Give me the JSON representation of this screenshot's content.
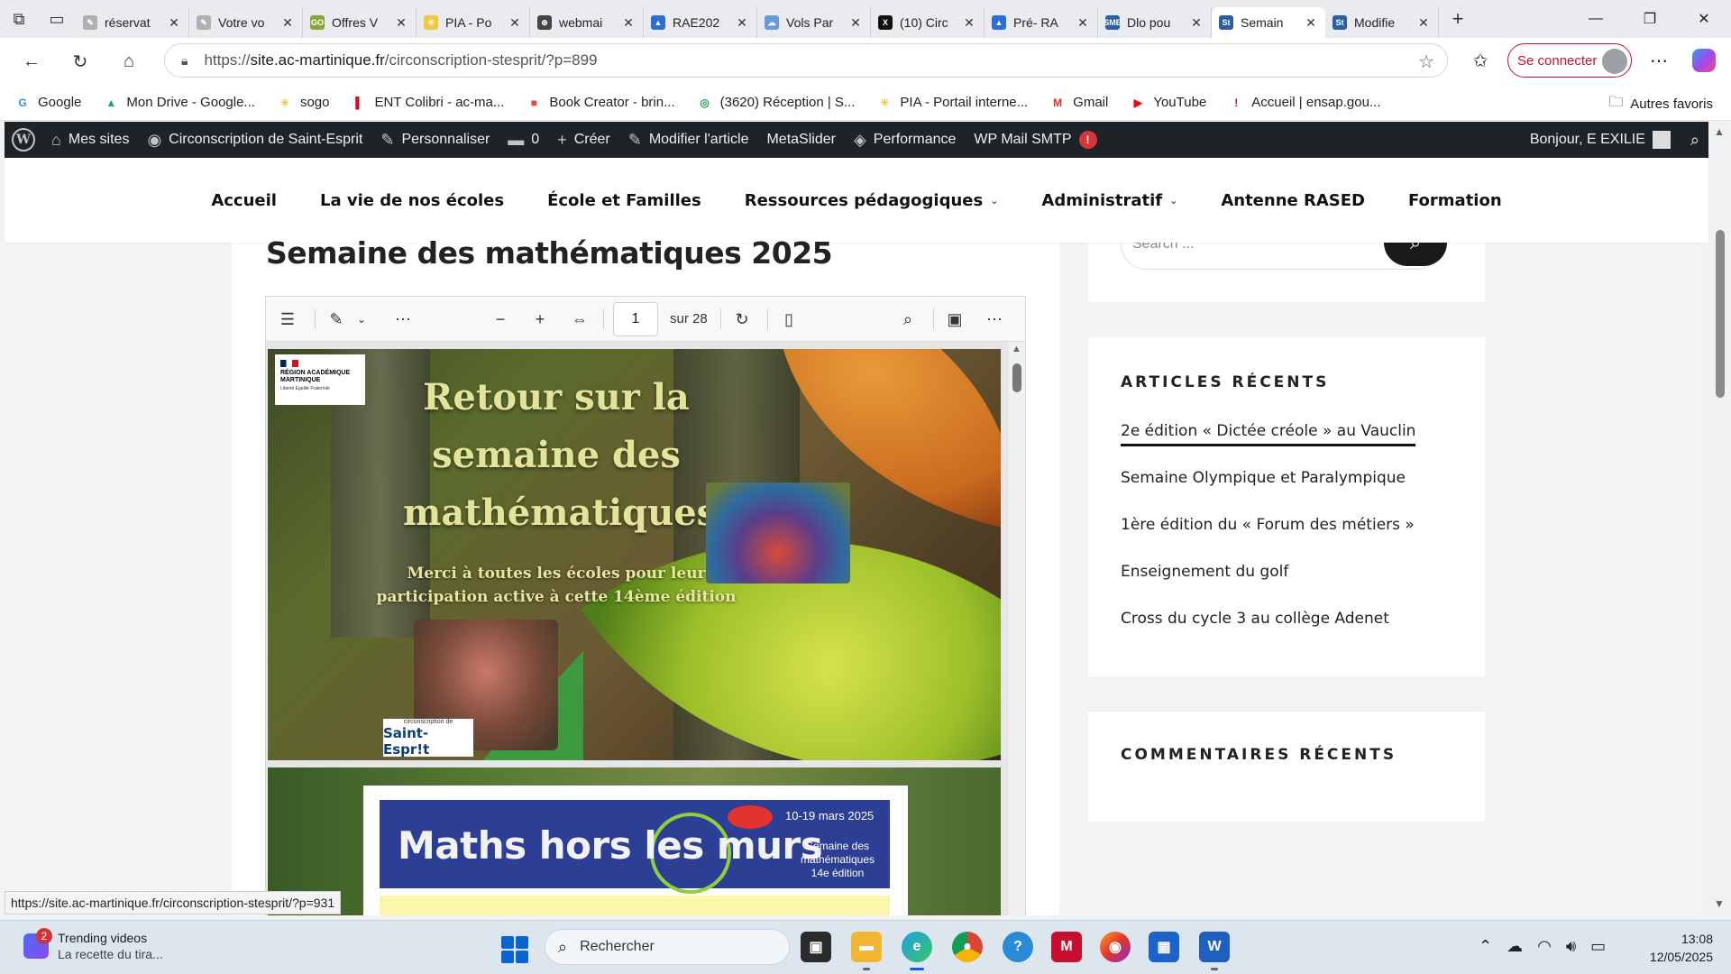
{
  "browser": {
    "tabs": [
      {
        "title": "réservat",
        "color": "#b0b0b0",
        "glyph": "✎"
      },
      {
        "title": "Votre vo",
        "color": "#b0b0b0",
        "glyph": "✎"
      },
      {
        "title": "Offres V",
        "color": "#8aa63a",
        "glyph": "GO"
      },
      {
        "title": "PIA - Po",
        "color": "#f2c744",
        "glyph": "☀"
      },
      {
        "title": "webmai",
        "color": "#444444",
        "glyph": "⊕"
      },
      {
        "title": "RAE202",
        "color": "#2a6fd6",
        "glyph": "▲"
      },
      {
        "title": "Vols Par",
        "color": "#6a9ad6",
        "glyph": "☁"
      },
      {
        "title": "(10) Circ",
        "color": "#111111",
        "glyph": "X"
      },
      {
        "title": "Pré- RA",
        "color": "#2a6fd6",
        "glyph": "▲"
      },
      {
        "title": "Dlo pou",
        "color": "#2a5fa8",
        "glyph": "SME"
      },
      {
        "title": "Semain",
        "color": "#2a5fa8",
        "glyph": "St"
      },
      {
        "title": "Modifie",
        "color": "#2a5fa8",
        "glyph": "St"
      }
    ],
    "active_tab_index": 10,
    "url_prefix": "https://",
    "url_domain": "site.ac-martinique.fr",
    "url_path": "/circonscription-stesprit/?p=899",
    "signin_label": "Se connecter",
    "favorites": [
      {
        "label": "Google",
        "glyph": "G",
        "color": "#4285f4"
      },
      {
        "label": "Mon Drive - Google...",
        "glyph": "▲",
        "color": "#1fa463"
      },
      {
        "label": "sogo",
        "glyph": "☀",
        "color": "#f2c744"
      },
      {
        "label": "ENT Colibri - ac-ma...",
        "glyph": "▌",
        "color": "#c8102e"
      },
      {
        "label": "Book Creator - brin...",
        "glyph": "■",
        "color": "#e8453c"
      },
      {
        "label": "(3620) Réception | S...",
        "glyph": "◎",
        "color": "#1f9e4a"
      },
      {
        "label": "PIA - Portail interne...",
        "glyph": "☀",
        "color": "#f2c744"
      },
      {
        "label": "Gmail",
        "glyph": "M",
        "color": "#d93025"
      },
      {
        "label": "YouTube",
        "glyph": "▶",
        "color": "#ff0000"
      },
      {
        "label": "Accueil | ensap.gou...",
        "glyph": "!",
        "color": "#c8102e"
      }
    ],
    "other_favorites": "Autres favoris",
    "status_url": "https://site.ac-martinique.fr/circonscription-stesprit/?p=931"
  },
  "wp_admin_bar": {
    "items": [
      {
        "label": "Mes sites",
        "icon": "⌂"
      },
      {
        "label": "Circonscription de Saint-Esprit",
        "icon": "◉"
      },
      {
        "label": "Personnaliser",
        "icon": "✎"
      },
      {
        "label": "0",
        "icon": "▬"
      },
      {
        "label": "Créer",
        "icon": "+"
      },
      {
        "label": "Modifier l'article",
        "icon": "✎"
      },
      {
        "label": "MetaSlider",
        "icon": ""
      },
      {
        "label": "Performance",
        "icon": "◈"
      },
      {
        "label": "WP Mail SMTP",
        "icon": ""
      }
    ],
    "smtp_badge": "!",
    "greeting": "Bonjour, E EXILIE"
  },
  "site": {
    "menu": [
      {
        "label": "Accueil",
        "dropdown": false
      },
      {
        "label": "La vie de nos écoles",
        "dropdown": false
      },
      {
        "label": "École et Familles",
        "dropdown": false
      },
      {
        "label": "Ressources pédagogiques",
        "dropdown": true
      },
      {
        "label": "Administratif",
        "dropdown": true
      },
      {
        "label": "Antenne RASED",
        "dropdown": false
      },
      {
        "label": "Formation",
        "dropdown": false
      }
    ],
    "page_title": "Semaine des mathématiques 2025",
    "pdf": {
      "current_page": "1",
      "total_label": "sur 28",
      "page1": {
        "logo_line1": "RÉGION ACADÉMIQUE",
        "logo_line2": "MARTINIQUE",
        "logo_motto": "Liberté Égalité Fraternité",
        "title": "Retour sur la semaine des mathématiques",
        "subtitle": "Merci à toutes les écoles pour leur participation active à cette 14ème édition",
        "circ_small": "circonscription de",
        "circ_name": "Saint-Espr!t"
      },
      "page2": {
        "banner_title": "Maths hors les murs",
        "dates": "10-19 mars 2025",
        "edition": "Semaine des mathématiques 14e édition"
      }
    },
    "sidebar": {
      "search_placeholder": "Search ...",
      "recent_title": "ARTICLES RÉCENTS",
      "recent_articles": [
        "2e édition « Dictée créole » au Vauclin",
        "Semaine Olympique et Paralympique",
        "1ère édition du « Forum des métiers »",
        "Enseignement du golf",
        "Cross du cycle 3 au collège Adenet"
      ],
      "comments_title": "COMMENTAIRES RÉCENTS"
    }
  },
  "taskbar": {
    "widget_badge": "2",
    "widget_line1": "Trending videos",
    "widget_line2": "La recette du tira...",
    "search_label": "Rechercher",
    "time": "13:08",
    "date": "12/05/2025"
  }
}
